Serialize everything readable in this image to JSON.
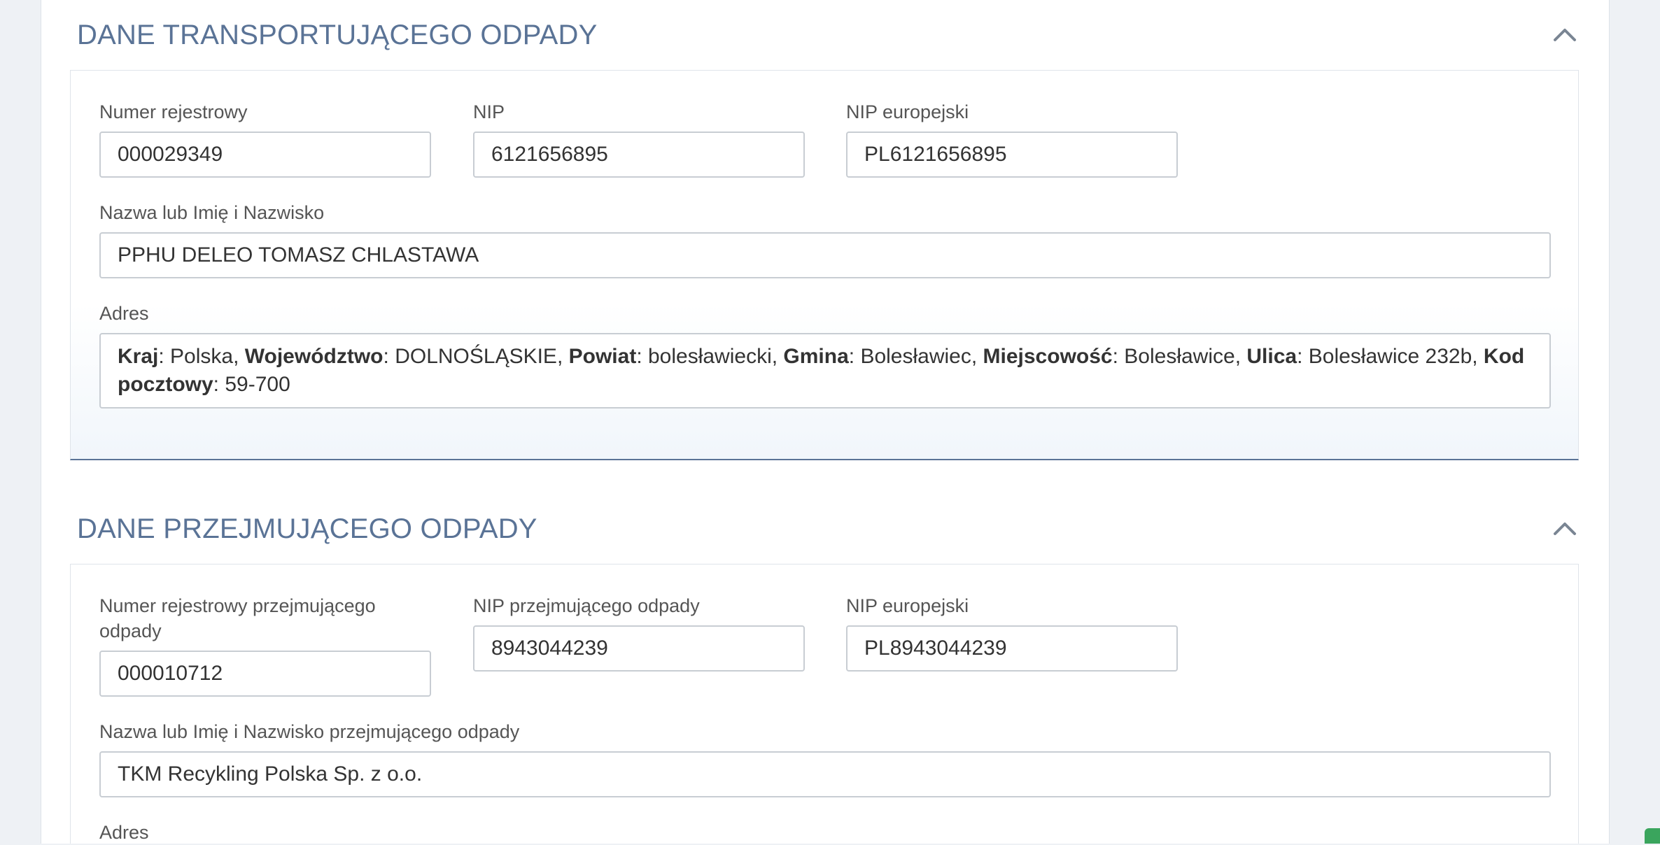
{
  "transporter": {
    "title": "DANE TRANSPORTUJĄCEGO ODPADY",
    "collapse_icon": "chevron-up-icon",
    "registry_label": "Numer rejestrowy",
    "registry_value": "000029349",
    "nip_label": "NIP",
    "nip_value": "6121656895",
    "eu_nip_label": "NIP europejski",
    "eu_nip_value": "PL6121656895",
    "name_label": "Nazwa lub Imię i Nazwisko",
    "name_value": "PPHU DELEO TOMASZ CHLASTAWA",
    "address_label": "Adres",
    "address": {
      "country_key": "Kraj",
      "country_val": "Polska",
      "voivodeship_key": "Województwo",
      "voivodeship_val": "DOLNOŚLĄSKIE",
      "county_key": "Powiat",
      "county_val": "bolesławiecki",
      "commune_key": "Gmina",
      "commune_val": "Bolesławiec",
      "town_key": "Miejscowość",
      "town_val": "Bolesławice",
      "street_key": "Ulica",
      "street_val": "Bolesławice 232b",
      "postal_key": "Kod pocztowy",
      "postal_val": "59-700"
    }
  },
  "receiver": {
    "title": "DANE PRZEJMUJĄCEGO ODPADY",
    "collapse_icon": "chevron-up-icon",
    "registry_label": "Numer rejestrowy przejmującego odpady",
    "registry_value": "000010712",
    "nip_label": "NIP przejmującego odpady",
    "nip_value": "8943044239",
    "eu_nip_label": "NIP europejski",
    "eu_nip_value": "PL8943044239",
    "name_label": "Nazwa lub Imię i Nazwisko przejmującego odpady",
    "name_value": "TKM Recykling Polska Sp. z o.o.",
    "address_label": "Adres"
  },
  "colors": {
    "title": "#5a7396",
    "background": "#eef1f5",
    "border": "#c8cdd3",
    "accent_green": "#3aa55d"
  }
}
